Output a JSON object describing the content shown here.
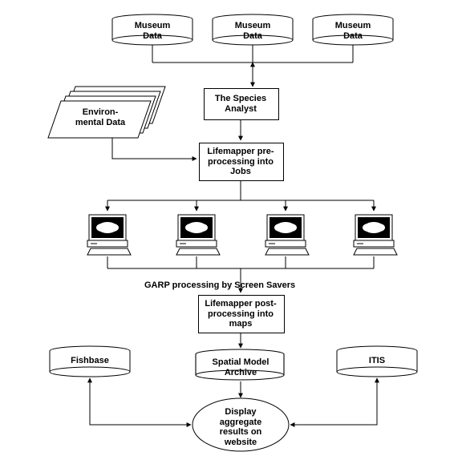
{
  "nodes": {
    "museum1": "Museum\nData",
    "museum2": "Museum\nData",
    "museum3": "Museum\nData",
    "envdata": "Environ-\nmental Data",
    "speciesAnalyst": "The Species\nAnalyst",
    "preprocess": "Lifemapper pre-\nprocessing into\nJobs",
    "garp": "GARP processing by    Screen Savers",
    "postprocess": "Lifemapper post-\nprocessing into\nmaps",
    "spatialArchive": "Spatial Model\nArchive",
    "fishbase": "Fishbase",
    "itis": "ITIS",
    "display": "Display\naggregate\nresults on\nwebsite"
  }
}
